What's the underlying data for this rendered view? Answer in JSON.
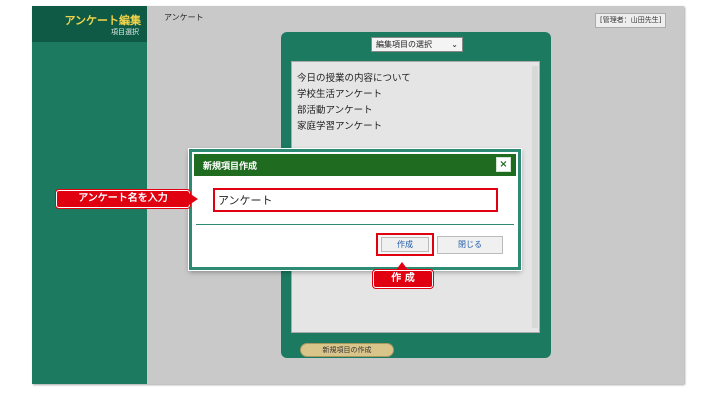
{
  "sidebar": {
    "title": "アンケート編集",
    "subtitle": "項目選択"
  },
  "topbar": {
    "title": "アンケート",
    "user_label": "[管理者：山田先生]"
  },
  "panel": {
    "select_value": "編集項目の選択",
    "items": [
      {
        "label": "今日の授業の内容について"
      },
      {
        "label": "学校生活アンケート"
      },
      {
        "label": "部活動アンケート"
      },
      {
        "label": "家庭学習アンケート"
      }
    ],
    "new_button_label": "新規項目の作成"
  },
  "modal": {
    "title": "新規項目作成",
    "close_glyph": "×",
    "input_value": "アンケート",
    "create_label": "作成",
    "close_label": "閉じる"
  },
  "callouts": {
    "name": "アンケート名を入力",
    "create": "作 成"
  },
  "colors": {
    "sidebar": "#1b7a60",
    "modal_header": "#1f6b1f",
    "callout": "#e00010",
    "title_accent": "#f2d44b"
  }
}
